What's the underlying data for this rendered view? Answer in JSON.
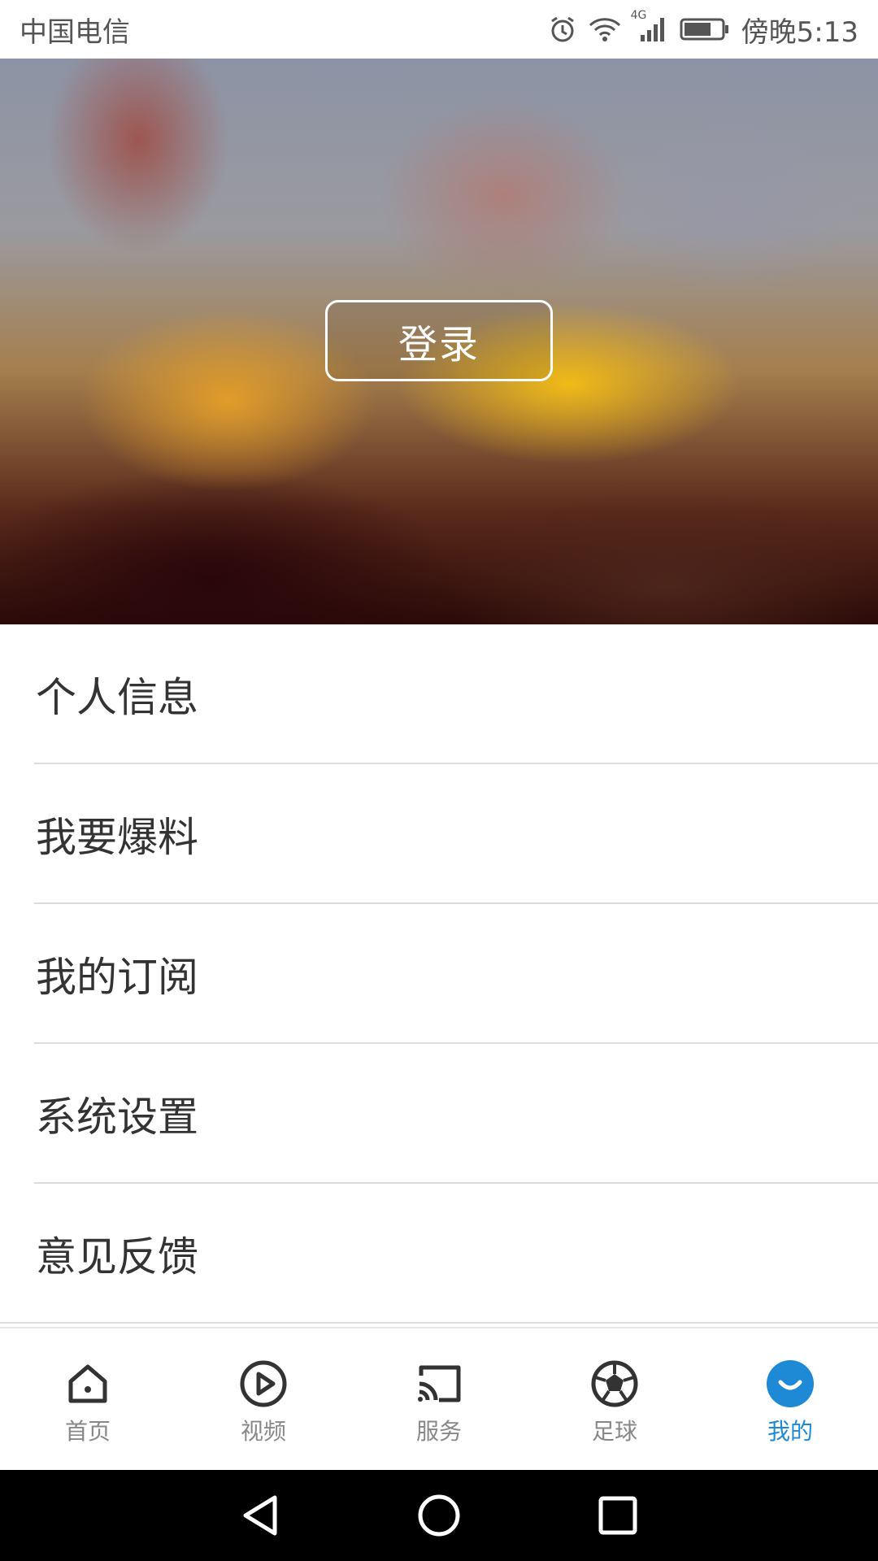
{
  "status_bar": {
    "carrier": "中国电信",
    "network": "4G",
    "time": "傍晚5:13"
  },
  "hero": {
    "login_label": "登录"
  },
  "menu": {
    "items": [
      {
        "label": "个人信息"
      },
      {
        "label": "我要爆料"
      },
      {
        "label": "我的订阅"
      },
      {
        "label": "系统设置"
      },
      {
        "label": "意见反馈"
      }
    ]
  },
  "bottom_nav": {
    "items": [
      {
        "label": "首页",
        "icon": "home-icon"
      },
      {
        "label": "视频",
        "icon": "play-icon"
      },
      {
        "label": "服务",
        "icon": "cast-icon"
      },
      {
        "label": "足球",
        "icon": "football-icon"
      },
      {
        "label": "我的",
        "icon": "smile-icon",
        "active": true
      }
    ]
  },
  "colors": {
    "accent": "#1e8ad6",
    "inactive": "#888888",
    "text": "#333333"
  }
}
